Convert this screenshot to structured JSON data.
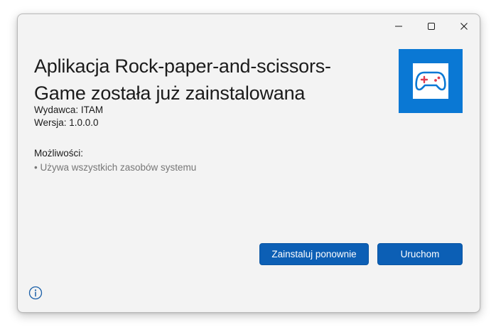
{
  "window": {
    "controls": {
      "minimize_icon": "minimize-icon",
      "maximize_icon": "maximize-icon",
      "close_icon": "close-icon"
    }
  },
  "main": {
    "title": "Aplikacja Rock-paper-and-scissors-Game została już zainstalowana",
    "publisher": "Wydawca: ITAM",
    "version": "Wersja: 1.0.0.0",
    "capabilities_label": "Możliwości:",
    "capabilities": [
      "• Używa wszystkich zasobów systemu"
    ]
  },
  "app_icon": {
    "icon": "gamepad-icon",
    "tile_color": "#0a78d4"
  },
  "actions": {
    "reinstall_label": "Zainstaluj ponownie",
    "launch_label": "Uruchom",
    "accent_color": "#0c5fb5"
  },
  "footer": {
    "info_icon": "info-icon"
  }
}
